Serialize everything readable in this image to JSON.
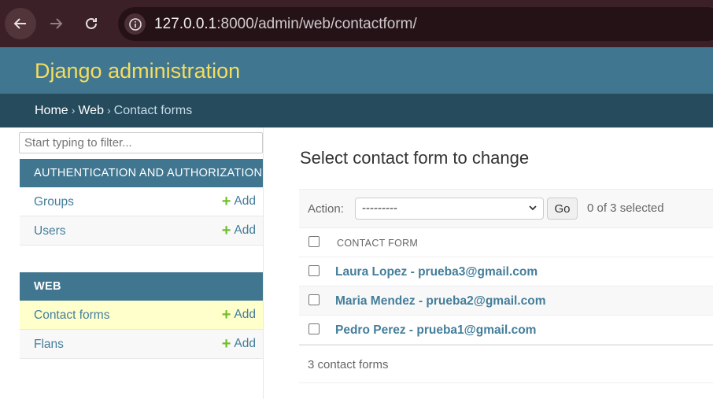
{
  "browser": {
    "url_host": "127.0.0.1",
    "url_rest": ":8000/admin/web/contactform/"
  },
  "header": {
    "site_name": "Django administration"
  },
  "breadcrumbs": {
    "home": "Home",
    "sep1": "›",
    "app": "Web",
    "sep2": "›",
    "current": "Contact forms"
  },
  "sidebar": {
    "filter_placeholder": "Start typing to filter...",
    "apps": [
      {
        "caption": "AUTHENTICATION AND AUTHORIZATION",
        "models": [
          {
            "name": "Groups",
            "add": "Add"
          },
          {
            "name": "Users",
            "add": "Add"
          }
        ]
      },
      {
        "caption": "WEB",
        "models": [
          {
            "name": "Contact forms",
            "add": "Add"
          },
          {
            "name": "Flans",
            "add": "Add"
          }
        ]
      }
    ]
  },
  "main": {
    "title": "Select contact form to change",
    "action_label": "Action:",
    "action_value": "---------",
    "go_label": "Go",
    "selected_count": "0 of 3 selected",
    "column_header": "CONTACT FORM",
    "rows": [
      "Laura Lopez - prueba3@gmail.com",
      "Maria Mendez - prueba2@gmail.com",
      "Pedro Perez - prueba1@gmail.com"
    ],
    "paginator": "3 contact forms"
  },
  "colors": {
    "header_bg": "#417690",
    "breadcrumb_bg": "#264b5d",
    "site_name": "#f5dd5d",
    "link": "#447e9b",
    "add_plus": "#70bf2b",
    "selected_row": "#ffffcc"
  }
}
